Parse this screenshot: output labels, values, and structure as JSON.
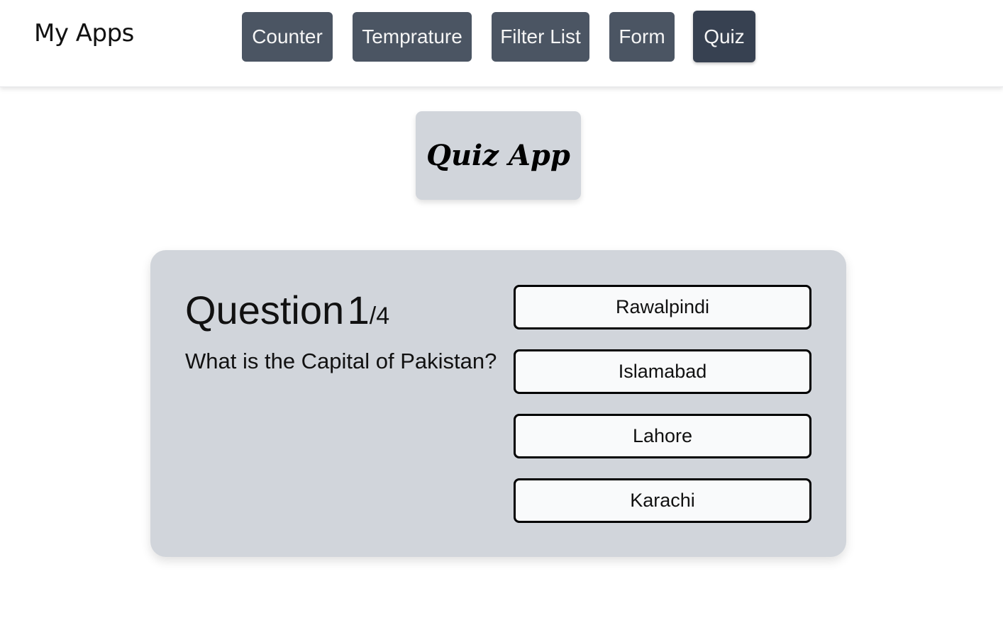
{
  "header": {
    "brand": "My Apps",
    "nav": [
      {
        "label": "Counter",
        "active": false
      },
      {
        "label": "Temprature",
        "active": false
      },
      {
        "label": "Filter List",
        "active": false
      },
      {
        "label": "Form",
        "active": false
      },
      {
        "label": "Quiz",
        "active": true
      }
    ]
  },
  "title_card": {
    "title": "Quiz App"
  },
  "quiz": {
    "question_word": "Question",
    "current": "1",
    "total": "/4",
    "question_text": "What is the Capital of Pakistan?",
    "answers": [
      "Rawalpindi",
      "Islamabad",
      "Lahore",
      "Karachi"
    ]
  },
  "colors": {
    "nav_button": "#4b5563",
    "nav_button_active": "#374151",
    "card_bg": "#d1d5db",
    "answer_bg": "#f9fafb"
  }
}
